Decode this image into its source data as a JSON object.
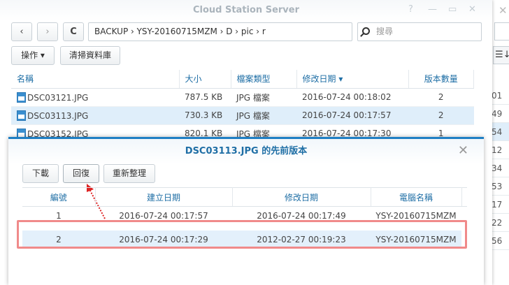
{
  "window": {
    "title": "Cloud Station Server",
    "help": "?",
    "minimize": "—",
    "maximize": "▭",
    "close": "✕"
  },
  "toolbar": {
    "back": "‹",
    "forward": "›",
    "refresh": "C",
    "path": "BACKUP  ›  YSY-20160715MZM  ›  D  ›  pic  ›  r",
    "search_placeholder": "搜尋"
  },
  "actions": {
    "operate": "操作 ▾",
    "clean": "清掃資料庫"
  },
  "table": {
    "headers": [
      "名稱",
      "大小",
      "檔案類型",
      "修改日期 ▾",
      "版本數量"
    ],
    "rows": [
      [
        "DSC03121.JPG",
        "787.5 KB",
        "JPG 檔案",
        "2016-07-24 00:18:02",
        "2"
      ],
      [
        "DSC03113.JPG",
        "730.3 KB",
        "JPG 檔案",
        "2016-07-24 00:17:57",
        "2"
      ],
      [
        "DSC03152.JPG",
        "820.1 KB",
        "JPG 檔案",
        "2016-07-24 00:17:30",
        "1"
      ]
    ]
  },
  "background_window": {
    "close": "✕",
    "sort": "☰↓",
    "numbers": [
      "01",
      "49",
      "54",
      "12",
      "34",
      "53",
      "17",
      "22",
      "56"
    ]
  },
  "dialog": {
    "title": "DSC03113.JPG 的先前版本",
    "close": "✕",
    "buttons": [
      "下載",
      "回復",
      "重新整理"
    ],
    "headers": [
      "編號",
      "建立日期",
      "修改日期",
      "電腦名稱"
    ],
    "rows": [
      [
        "1",
        "2016-07-24 00:17:57",
        "2016-07-24 00:17:49",
        "YSY-20160715MZM"
      ],
      [
        "2",
        "2016-07-24 00:17:29",
        "2012-02-27 00:19:23",
        "YSY-20160715MZM"
      ]
    ]
  }
}
